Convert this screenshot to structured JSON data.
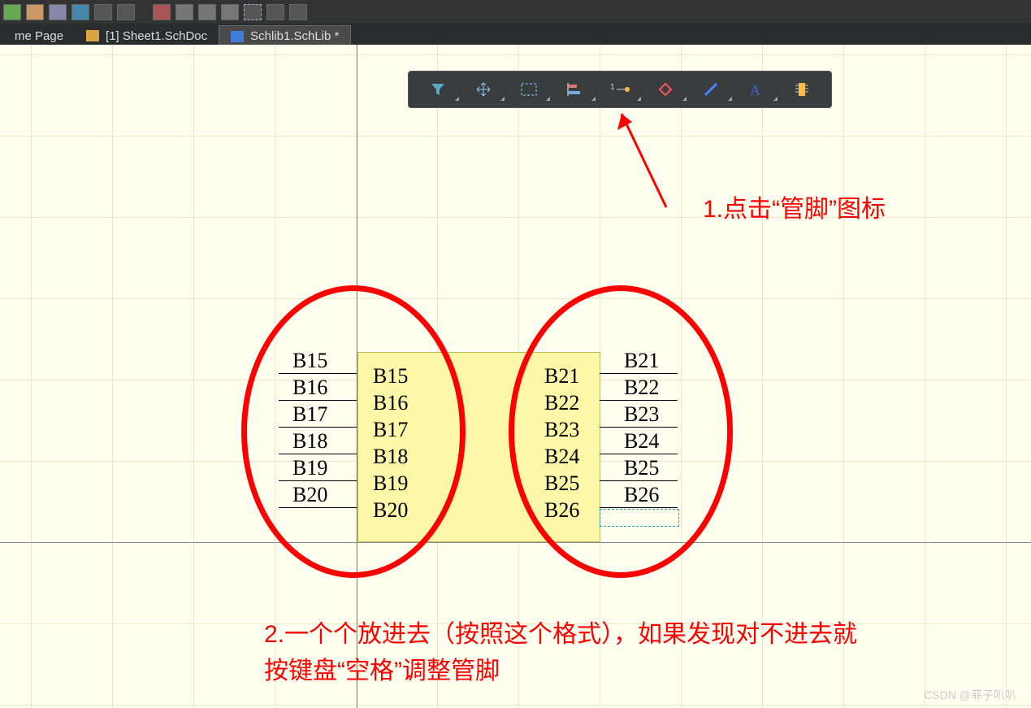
{
  "tabs": {
    "t0": "me Page",
    "t1": "[1] Sheet1.SchDoc",
    "t2": "Schlib1.SchLib *"
  },
  "float_tools": {
    "filter": "filter-icon",
    "move": "move-icon",
    "select": "selection-icon",
    "align": "align-icon",
    "pin": "pin-icon",
    "ieee": "ieee-symbol-icon",
    "line": "line-icon",
    "text": "text-icon",
    "component": "component-icon"
  },
  "pins_left": {
    "d0": "B15",
    "n0": "B15",
    "d1": "B16",
    "n1": "B16",
    "d2": "B17",
    "n2": "B17",
    "d3": "B18",
    "n3": "B18",
    "d4": "B19",
    "n4": "B19",
    "d5": "B20",
    "n5": "B20"
  },
  "pins_right": {
    "d0": "B21",
    "n0": "B21",
    "d1": "B22",
    "n1": "B22",
    "d2": "B23",
    "n2": "B23",
    "d3": "B24",
    "n3": "B24",
    "d4": "B25",
    "n4": "B25",
    "d5": "B26",
    "n5": "B26"
  },
  "annotation1": "1.点击“管脚”图标",
  "annotation2": "2.一个个放进去（按照这个格式），如果发现对不进去就按键盘“空格”调整管脚",
  "watermark": "CSDN @菲子叭叭"
}
